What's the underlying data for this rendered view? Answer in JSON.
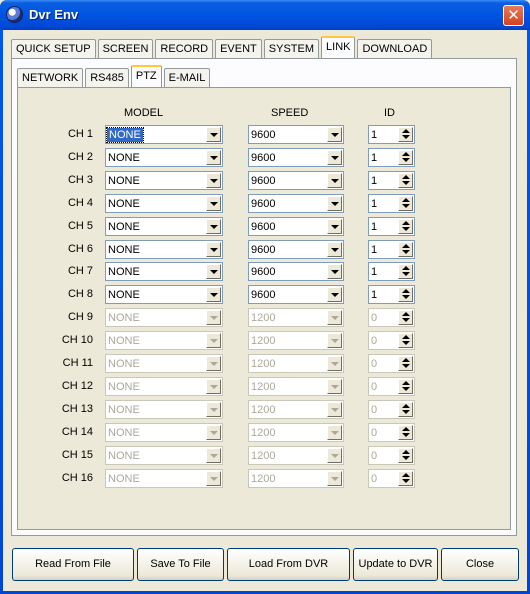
{
  "window": {
    "title": "Dvr Env",
    "close_glyph": "✕"
  },
  "outer_tabs": [
    "QUICK SETUP",
    "SCREEN",
    "RECORD",
    "EVENT",
    "SYSTEM",
    "LINK",
    "DOWNLOAD"
  ],
  "outer_active": "LINK",
  "inner_tabs": [
    "NETWORK",
    "RS485",
    "PTZ",
    "E-MAIL"
  ],
  "inner_active": "PTZ",
  "headers": {
    "model": "MODEL",
    "speed": "SPEED",
    "id": "ID"
  },
  "channels": [
    {
      "label": "CH  1",
      "model": "NONE",
      "speed": "9600",
      "id": "1",
      "enabled": true,
      "focused": true
    },
    {
      "label": "CH  2",
      "model": "NONE",
      "speed": "9600",
      "id": "1",
      "enabled": true
    },
    {
      "label": "CH  3",
      "model": "NONE",
      "speed": "9600",
      "id": "1",
      "enabled": true
    },
    {
      "label": "CH  4",
      "model": "NONE",
      "speed": "9600",
      "id": "1",
      "enabled": true
    },
    {
      "label": "CH  5",
      "model": "NONE",
      "speed": "9600",
      "id": "1",
      "enabled": true
    },
    {
      "label": "CH  6",
      "model": "NONE",
      "speed": "9600",
      "id": "1",
      "enabled": true
    },
    {
      "label": "CH  7",
      "model": "NONE",
      "speed": "9600",
      "id": "1",
      "enabled": true
    },
    {
      "label": "CH  8",
      "model": "NONE",
      "speed": "9600",
      "id": "1",
      "enabled": true
    },
    {
      "label": "CH  9",
      "model": "NONE",
      "speed": "1200",
      "id": "0",
      "enabled": false
    },
    {
      "label": "CH 10",
      "model": "NONE",
      "speed": "1200",
      "id": "0",
      "enabled": false
    },
    {
      "label": "CH 11",
      "model": "NONE",
      "speed": "1200",
      "id": "0",
      "enabled": false
    },
    {
      "label": "CH 12",
      "model": "NONE",
      "speed": "1200",
      "id": "0",
      "enabled": false
    },
    {
      "label": "CH 13",
      "model": "NONE",
      "speed": "1200",
      "id": "0",
      "enabled": false
    },
    {
      "label": "CH 14",
      "model": "NONE",
      "speed": "1200",
      "id": "0",
      "enabled": false
    },
    {
      "label": "CH 15",
      "model": "NONE",
      "speed": "1200",
      "id": "0",
      "enabled": false
    },
    {
      "label": "CH 16",
      "model": "NONE",
      "speed": "1200",
      "id": "0",
      "enabled": false
    }
  ],
  "buttons": [
    "Read From File",
    "Save To File",
    "Load From DVR",
    "Update to DVR",
    "Close"
  ],
  "colors": {
    "titlebar": "#0054e3",
    "face": "#ece9d8",
    "selection": "#316ac5",
    "active_tab_accent": "#ffc83c"
  }
}
